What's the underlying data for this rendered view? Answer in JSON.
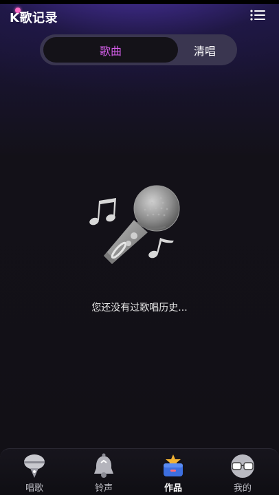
{
  "header": {
    "app_title": "K歌记录",
    "menu_icon": "list-menu-icon"
  },
  "segmented": {
    "tabs": [
      {
        "label": "歌曲",
        "selected": true
      },
      {
        "label": "清唱",
        "selected": false
      }
    ],
    "active_color": "#d15de6"
  },
  "empty_state": {
    "illustration": "microphone-with-music-notes-icon",
    "message": "您还没有过歌唱历史..."
  },
  "tabbar": {
    "items": [
      {
        "label": "唱歌",
        "icon": "singing-mic-icon",
        "selected": false
      },
      {
        "label": "铃声",
        "icon": "bell-icon",
        "selected": false
      },
      {
        "label": "作品",
        "icon": "works-box-icon",
        "selected": true
      },
      {
        "label": "我的",
        "icon": "glasses-avatar-icon",
        "selected": false
      }
    ]
  }
}
